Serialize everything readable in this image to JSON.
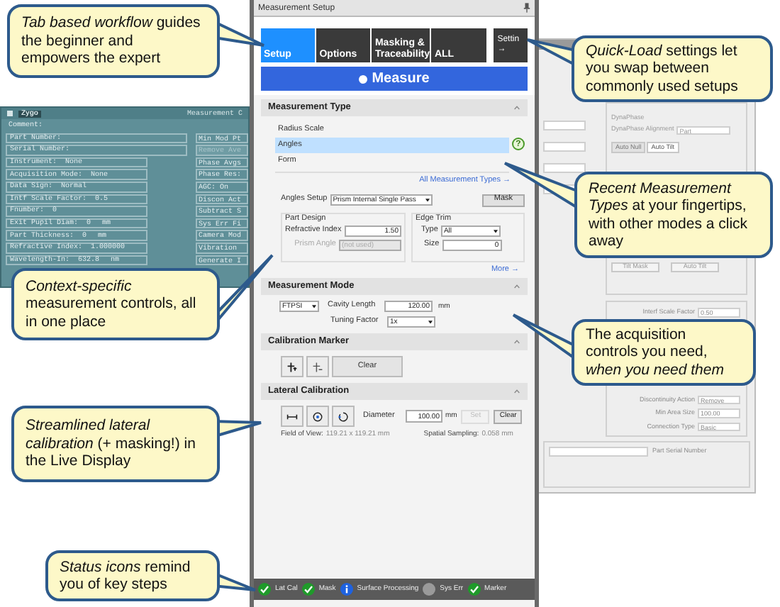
{
  "legacy_window": {
    "title": "Zygo",
    "title_right": "Measurement C",
    "left_fields": [
      {
        "label": "Comment:"
      },
      {
        "label": "Part Number:"
      },
      {
        "label": "Serial Number:"
      },
      {
        "label": "Instrument:",
        "value": "None"
      },
      {
        "label": "Acquisition Mode:",
        "value": "None"
      },
      {
        "label": "Data Sign:",
        "value": "Normal"
      },
      {
        "label": "Intf Scale Factor:",
        "value": "0.5"
      },
      {
        "label": "Fnumber:",
        "value": "0"
      },
      {
        "label": "Exit Pupil Diam:",
        "value": "0",
        "unit": "mm"
      },
      {
        "label": "Part Thickness:",
        "value": "0",
        "unit": "mm"
      },
      {
        "label": "Refractive Index:",
        "value": "1.000000"
      },
      {
        "label": "Wavelength-In:",
        "value": "632.8",
        "unit": "nm"
      }
    ],
    "right_fields": [
      {
        "label": "Min Mod Pt",
        "disabled": false
      },
      {
        "label": "Remove Ave",
        "disabled": true
      },
      {
        "label": "Phase Avgs",
        "disabled": false
      },
      {
        "label": "Phase Res:",
        "disabled": false
      },
      {
        "label": "AGC:  On",
        "disabled": false
      },
      {
        "label": "Discon Act",
        "disabled": false
      },
      {
        "label": "Subtract S",
        "disabled": false
      },
      {
        "label": "Sys Err Fi",
        "disabled": false
      },
      {
        "label": "Camera Mod",
        "disabled": false
      },
      {
        "label": "Vibration",
        "disabled": false
      },
      {
        "label": "Generate I",
        "disabled": false
      }
    ]
  },
  "settings_window": {
    "top_labels": [
      "DynaPhase",
      "DynaPhase Alignment"
    ],
    "alignment_value": "Part",
    "tabs": [
      {
        "label": "Auto Null",
        "selected": false
      },
      {
        "label": "Auto Tilt",
        "selected": true
      }
    ],
    "buttons": [
      "Tilt Mask",
      "Auto Tilt"
    ],
    "fields": [
      {
        "label": "Interf Scale Factor",
        "value": "0.50"
      },
      {
        "label": "Discontinuity Action",
        "value": "Remove"
      },
      {
        "label": "Min Area Size",
        "value": "100.00"
      },
      {
        "label": "Connection Type",
        "value": "Basic"
      }
    ],
    "serial_label": "Part Serial Number"
  },
  "panel": {
    "title": "Measurement Setup",
    "tabs": [
      {
        "label": "Setup",
        "selected": true
      },
      {
        "label": "Options",
        "selected": false
      },
      {
        "label": "Masking & Traceability",
        "selected": false
      },
      {
        "label": "ALL",
        "selected": false
      }
    ],
    "quick_load": {
      "label": "Settin",
      "arrow": "→"
    },
    "measure_button": "Measure",
    "measurement_type": {
      "header": "Measurement Type",
      "expanded": true,
      "items": [
        {
          "label": "Radius Scale",
          "selected": false
        },
        {
          "label": "Angles",
          "selected": true
        },
        {
          "label": "Form",
          "selected": false
        }
      ],
      "help_glyph": "?",
      "all_link": "All Measurement Types →",
      "setup_label": "Angles Setup",
      "setup_value": "Prism Internal Single Pass",
      "mask_button": "Mask",
      "part_design": {
        "title": "Part Design",
        "fields": [
          {
            "label": "Refractive Index",
            "value": "1.50",
            "disabled": false
          },
          {
            "label": "Prism Angle",
            "value": "(not used)",
            "disabled": true
          }
        ]
      },
      "edge_trim": {
        "title": "Edge Trim",
        "type_label": "Type",
        "type_value": "All",
        "size_label": "Size",
        "size_value": "0"
      },
      "more_link": "More →"
    },
    "measurement_mode": {
      "header": "Measurement Mode",
      "expanded": true,
      "mode_value": "FTPSI",
      "cavity_label": "Cavity Length",
      "cavity_value": "120.00",
      "cavity_unit": "mm",
      "tuning_label": "Tuning Factor",
      "tuning_value": "1x"
    },
    "calibration_marker": {
      "header": "Calibration Marker",
      "expanded": true,
      "clear_button": "Clear"
    },
    "lateral_calibration": {
      "header": "Lateral Calibration",
      "expanded": true,
      "diameter_label": "Diameter",
      "diameter_value": "100.00",
      "diameter_unit": "mm",
      "set_button": {
        "label": "Set",
        "disabled": true
      },
      "clear_button": {
        "label": "Clear",
        "disabled": false
      },
      "fov_label": "Field of View:",
      "fov_value": "119.21 x 119.21 mm",
      "sampling_label": "Spatial Sampling:",
      "sampling_value": "0.058 mm"
    },
    "status": [
      {
        "label": "Lat Cal",
        "kind": "ok"
      },
      {
        "label": "Mask",
        "kind": "ok"
      },
      {
        "label": "Surface Processing",
        "kind": "info"
      },
      {
        "label": "Sys Err",
        "kind": "off"
      },
      {
        "label": "Marker",
        "kind": "ok"
      }
    ]
  },
  "callouts": [
    {
      "text": "*Tab based workflow* guides the beginner and empowers the expert"
    },
    {
      "text": "*Quick-Load* settings let you swap between commonly used setups"
    },
    {
      "text": "*Recent Measurement Types* at your fingertips, with other modes a click away"
    },
    {
      "text": "*Context-specific* measurement controls, all in one place"
    },
    {
      "text": "The acquisition controls you need, *when you need them*"
    },
    {
      "text": "*Streamlined lateral calibration* (+ masking!) in the Live Display"
    },
    {
      "text": "*Status icons* remind you of key steps"
    }
  ]
}
